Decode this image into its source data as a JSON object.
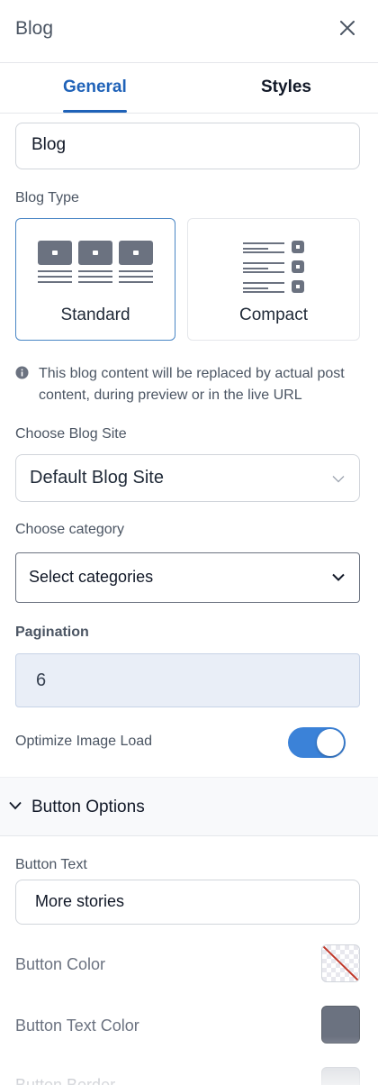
{
  "header": {
    "title": "Blog"
  },
  "tabs": [
    {
      "label": "General",
      "active": true
    },
    {
      "label": "Styles",
      "active": false
    }
  ],
  "name_input": {
    "value": "Blog"
  },
  "blog_type": {
    "label": "Blog Type",
    "options": [
      {
        "label": "Standard",
        "selected": true
      },
      {
        "label": "Compact",
        "selected": false
      }
    ]
  },
  "info": {
    "text": "This blog content will be replaced by actual post content, during preview or in the live URL"
  },
  "blog_site": {
    "label": "Choose Blog Site",
    "value": "Default Blog Site"
  },
  "category": {
    "label": "Choose category",
    "placeholder": "Select categories"
  },
  "pagination": {
    "label": "Pagination",
    "value": "6"
  },
  "optimize_image": {
    "label": "Optimize Image Load",
    "enabled": true
  },
  "button_options": {
    "title": "Button Options",
    "expanded": true,
    "button_text_label": "Button Text",
    "button_text_value": "More stories",
    "button_color_label": "Button Color",
    "button_text_color_label": "Button Text Color",
    "button_border_label": "Button Border"
  },
  "colors": {
    "accent": "#1f62b8",
    "toggle_on": "#3b82d8",
    "button_text_color": "#6b7280",
    "button_border_color": "#c8ccd3"
  }
}
